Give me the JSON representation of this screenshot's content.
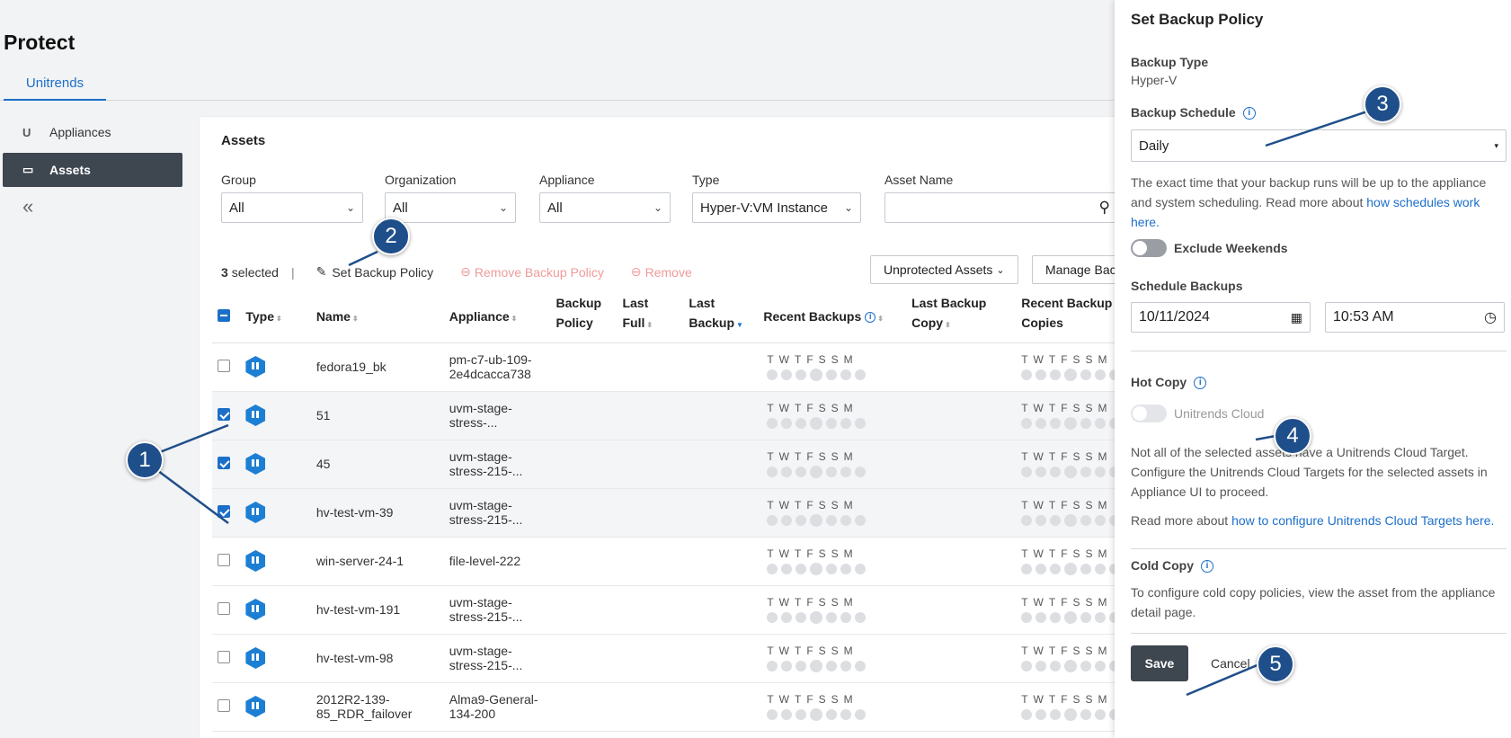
{
  "page": {
    "title": "Protect",
    "tab": "Unitrends"
  },
  "sidebar": {
    "items": [
      {
        "label": "Appliances",
        "icon": "unitrends-logo-icon"
      },
      {
        "label": "Assets",
        "icon": "assets-icon",
        "active": true
      }
    ],
    "collapse_glyph": "«"
  },
  "assets": {
    "title": "Assets",
    "filters": {
      "group": {
        "label": "Group",
        "value": "All"
      },
      "organization": {
        "label": "Organization",
        "value": "All"
      },
      "appliance": {
        "label": "Appliance",
        "value": "All"
      },
      "type": {
        "label": "Type",
        "value": "Hyper-V:VM Instance"
      },
      "asset_name": {
        "label": "Asset Name",
        "value": ""
      }
    },
    "toolbar": {
      "selected_count": "3",
      "selected_label": "selected",
      "separator": "|",
      "set_policy": "Set Backup Policy",
      "remove_policy": "Remove Backup Policy",
      "remove": "Remove",
      "unprotected": "Unprotected Assets",
      "manage": "Manage Backups"
    },
    "columns": {
      "type": "Type",
      "name": "Name",
      "appliance": "Appliance",
      "policy": "Backup Policy",
      "last_full": "Last Full",
      "last_backup": "Last Backup",
      "recent": "Recent Backups",
      "last_copy": "Last Backup Copy",
      "recent_copies": "Recent Backup Copies"
    },
    "day_letters": "TWTFSSM",
    "rows": [
      {
        "name": "fedora19_bk",
        "appliance": "pm-c7-ub-109-2e4dcacca738",
        "selected": false
      },
      {
        "name": "51",
        "appliance": "uvm-stage-stress-...",
        "selected": true
      },
      {
        "name": "45",
        "appliance": "uvm-stage-stress-215-...",
        "selected": true
      },
      {
        "name": "hv-test-vm-39",
        "appliance": "uvm-stage-stress-215-...",
        "selected": true
      },
      {
        "name": "win-server-24-1",
        "appliance": "file-level-222",
        "selected": false
      },
      {
        "name": "hv-test-vm-191",
        "appliance": "uvm-stage-stress-215-...",
        "selected": false
      },
      {
        "name": "hv-test-vm-98",
        "appliance": "uvm-stage-stress-215-...",
        "selected": false
      },
      {
        "name": "2012R2-139-85_RDR_failover",
        "appliance": "Alma9-General-134-200",
        "selected": false
      }
    ]
  },
  "drawer": {
    "title": "Set Backup Policy",
    "backup_type_label": "Backup Type",
    "backup_type_value": "Hyper-V",
    "schedule_label": "Backup Schedule",
    "schedule_value": "Daily",
    "schedule_note": "The exact time that your backup runs will be up to the appliance and system scheduling. Read more about",
    "schedule_link": "how schedules work here.",
    "exclude_weekends": "Exclude Weekends",
    "schedule_backups_label": "Schedule Backups",
    "date_value": "10/11/2024",
    "time_value": "10:53 AM",
    "hot_copy_label": "Hot Copy",
    "hot_copy_toggle": "Unitrends Cloud",
    "hot_copy_note": "Not all of the selected assets have a Unitrends Cloud Target. Configure the Unitrends Cloud Targets for the selected assets in Appliance UI to proceed.",
    "read_more": "Read more about",
    "cloud_link": "how to configure Unitrends Cloud Targets here.",
    "cold_copy_label": "Cold Copy",
    "cold_copy_note": "To configure cold copy policies, view the asset from the appliance detail page.",
    "save": "Save",
    "cancel": "Cancel"
  },
  "callouts": [
    "1",
    "2",
    "3",
    "4",
    "5"
  ],
  "colors": {
    "accent": "#1c6fc9",
    "callout": "#1f4f8a",
    "dark": "#3e4650"
  }
}
